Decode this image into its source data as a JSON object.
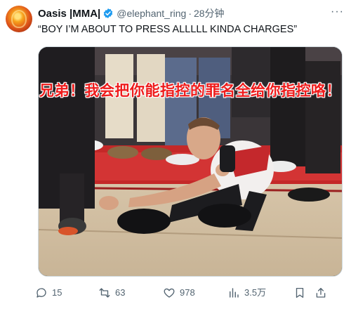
{
  "post": {
    "author_name": "Oasis |MMA|",
    "handle": "@elephant_ring",
    "separator": "·",
    "time": "28分钟",
    "text": "“BOY I’M ABOUT TO PRESS ALLLLL KINDA CHARGES”",
    "more_label": "···"
  },
  "media": {
    "subtitle": "兄弟！我会把你能指控的罪名全给你指控咯！"
  },
  "actions": {
    "replies": "15",
    "reposts": "63",
    "likes": "978",
    "views": "3.5万"
  },
  "icons": {
    "verified": "verified-badge-icon",
    "reply": "reply-icon",
    "repost": "repost-icon",
    "like": "heart-icon",
    "views": "views-chart-icon",
    "bookmark": "bookmark-icon",
    "share": "share-icon"
  },
  "colors": {
    "accent": "#1d9bf0",
    "muted": "#536471",
    "subtitle_red": "#ee1c1c"
  }
}
